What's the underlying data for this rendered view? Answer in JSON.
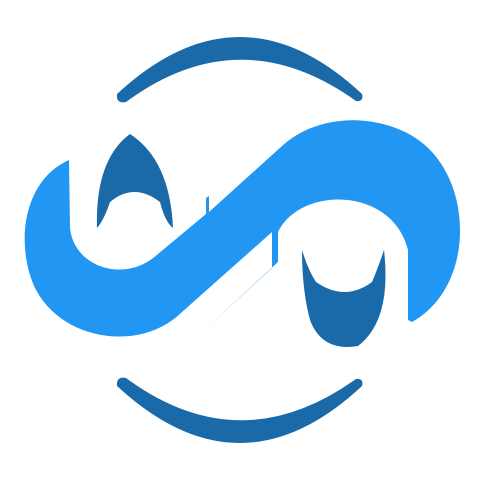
{
  "app_icon": {
    "background_color": "#ffffff",
    "colors": {
      "dark_blue": "#1a6aaa",
      "light_blue": "#2196f3"
    },
    "icon_name": "abstract-s-wave-logo"
  }
}
